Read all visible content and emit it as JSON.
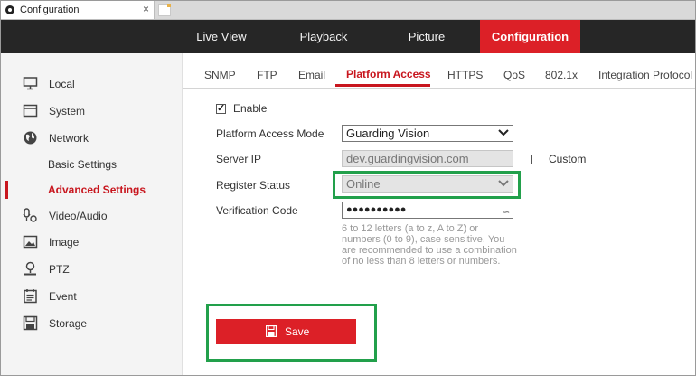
{
  "browser": {
    "tab_title": "Configuration",
    "close_glyph": "×"
  },
  "topnav": {
    "items": [
      "Live View",
      "Playback",
      "Picture",
      "Configuration"
    ],
    "active": "Configuration"
  },
  "sidebar": {
    "items": [
      {
        "label": "Local",
        "icon": "monitor-icon"
      },
      {
        "label": "System",
        "icon": "system-icon"
      },
      {
        "label": "Network",
        "icon": "globe-icon"
      },
      {
        "label": "Basic Settings",
        "icon": ""
      },
      {
        "label": "Advanced Settings",
        "icon": ""
      },
      {
        "label": "Video/Audio",
        "icon": "video-audio-icon"
      },
      {
        "label": "Image",
        "icon": "image-icon"
      },
      {
        "label": "PTZ",
        "icon": "ptz-icon"
      },
      {
        "label": "Event",
        "icon": "event-icon"
      },
      {
        "label": "Storage",
        "icon": "storage-icon"
      }
    ],
    "active": "Advanced Settings"
  },
  "subtabs": {
    "items": [
      "SNMP",
      "FTP",
      "Email",
      "Platform Access",
      "HTTPS",
      "QoS",
      "802.1x",
      "Integration Protocol"
    ],
    "active": "Platform Access"
  },
  "form": {
    "enable_label": "Enable",
    "enable_checked": true,
    "mode_label": "Platform Access Mode",
    "mode_value": "Guarding Vision",
    "server_ip_label": "Server IP",
    "server_ip_value": "dev.guardingvision.com",
    "custom_label": "Custom",
    "custom_checked": false,
    "register_label": "Register Status",
    "register_value": "Online",
    "verification_label": "Verification Code",
    "verification_value": "●●●●●●●●●●",
    "hint": "6 to 12 letters (a to z, A to Z) or numbers (0 to 9), case sensitive. You are recommended to use a combination of no less than 8 letters or numbers.",
    "save_label": "Save"
  },
  "colors": {
    "accent": "#dc2027",
    "highlight": "#22a04b",
    "nav_bg": "#262626"
  }
}
